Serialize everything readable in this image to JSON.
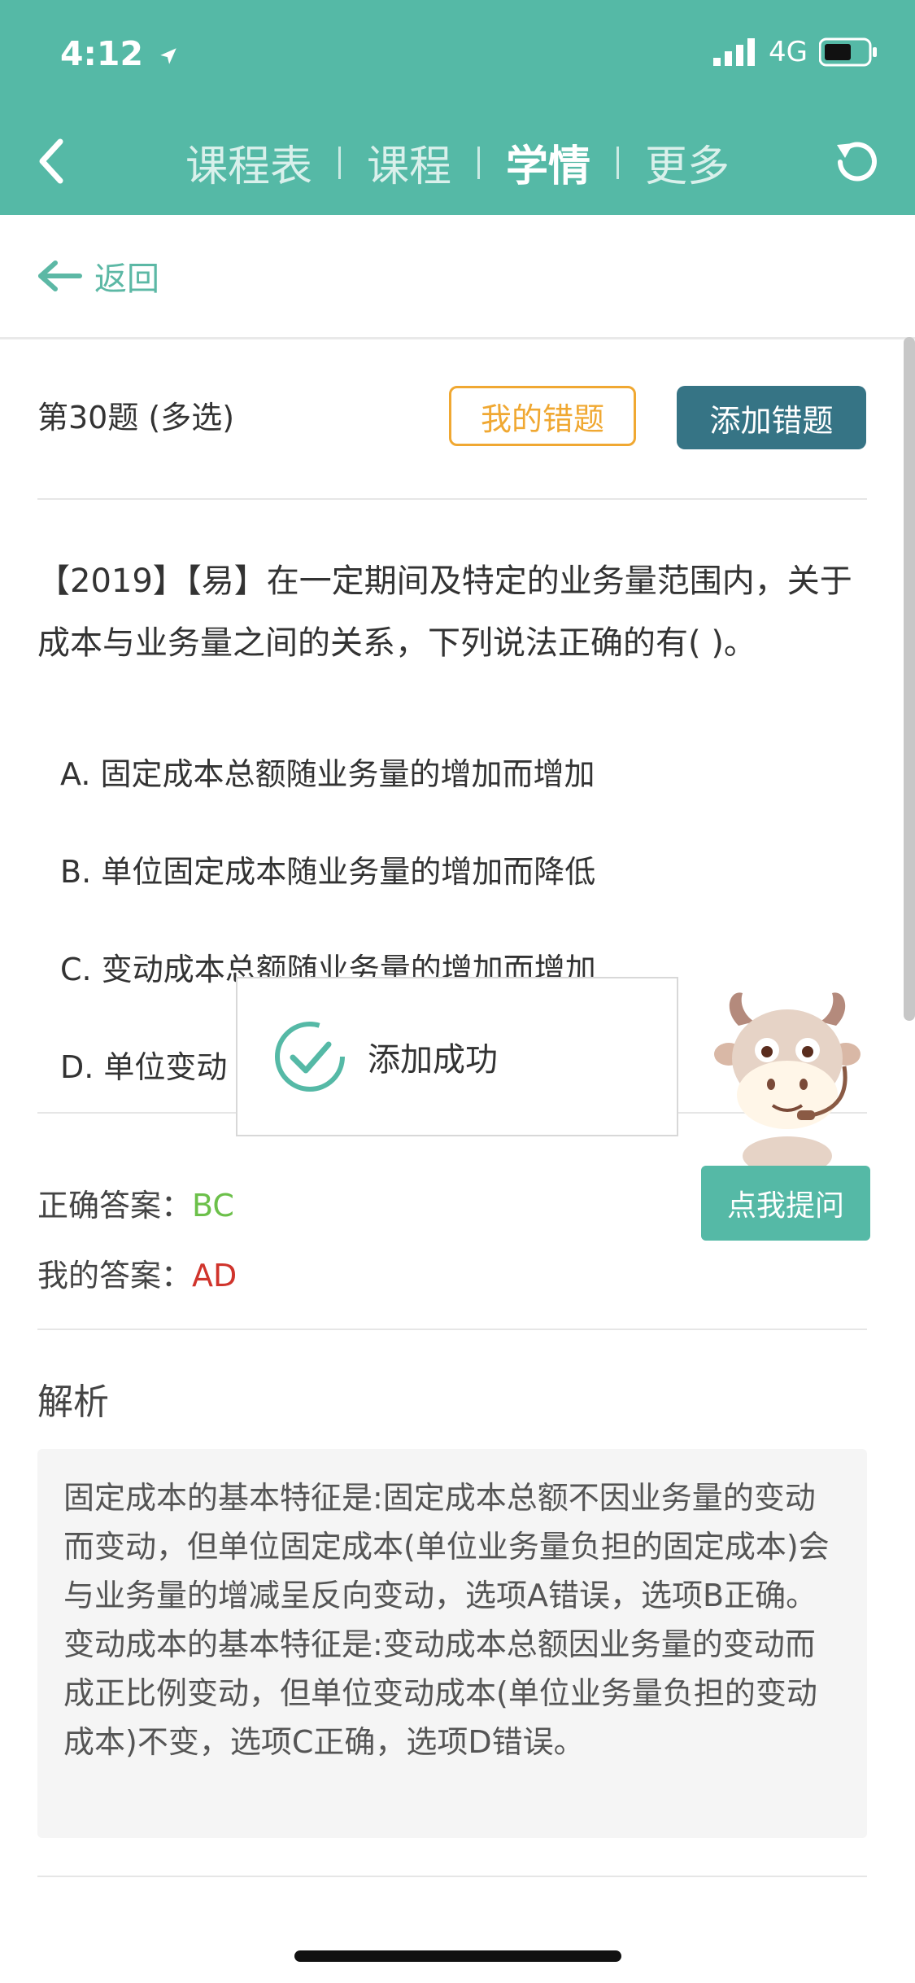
{
  "status_bar": {
    "time": "4:12",
    "network": "4G"
  },
  "nav": {
    "tabs": [
      {
        "label": "课程表",
        "active": false
      },
      {
        "label": "课程",
        "active": false
      },
      {
        "label": "学情",
        "active": true
      },
      {
        "label": "更多",
        "active": false
      }
    ]
  },
  "back_link": {
    "label": "返回"
  },
  "question": {
    "title": "第30题 (多选)",
    "my_mistakes_label": "我的错题",
    "add_mistake_label": "添加错题",
    "stem": "【2019】【易】在一定期间及特定的业务量范围内，关于成本与业务量之间的关系，下列说法正确的有( )。",
    "options": [
      "A. 固定成本总额随业务量的增加而增加",
      "B. 单位固定成本随业务量的增加而降低",
      "C. 变动成本总额随业务量的增加而增加",
      "D. 单位变动"
    ]
  },
  "toast": {
    "message": "添加成功"
  },
  "ask_button": {
    "label": "点我提问"
  },
  "answers": {
    "correct_label": "正确答案：",
    "correct_value": "BC",
    "mine_label": "我的答案：",
    "mine_value": "AD"
  },
  "analysis": {
    "title": "解析",
    "text": "固定成本的基本特征是:固定成本总额不因业务量的变动而变动，但单位固定成本(单位业务量负担的固定成本)会与业务量的增减呈反向变动，选项A错误，选项B正确。变动成本的基本特征是:变动成本总额因业务量的变动而成正比例变动，但单位变动成本(单位业务量负担的变动成本)不变，选项C正确，选项D错误。"
  },
  "colors": {
    "brand": "#55b9a6",
    "add_button": "#367485",
    "mistakes_outline": "#f0a832",
    "correct": "#6cc04a",
    "wrong": "#d0342c"
  }
}
